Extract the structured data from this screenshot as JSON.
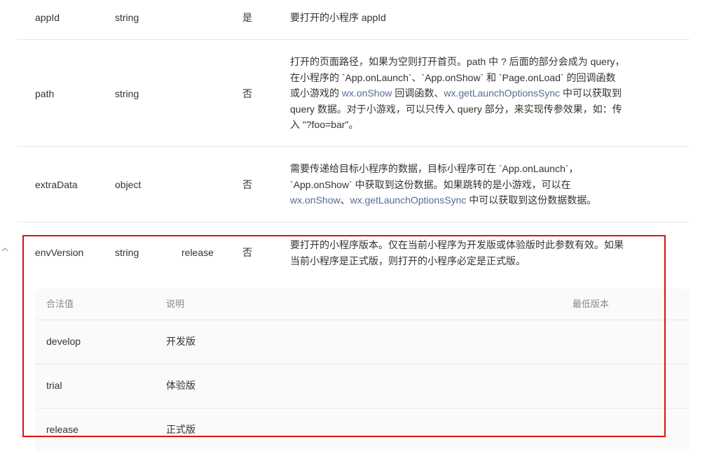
{
  "rows": [
    {
      "name": "appId",
      "type": "string",
      "default": "",
      "required": "是",
      "desc_parts": [
        "要打开的小程序 appId"
      ]
    },
    {
      "name": "path",
      "type": "string",
      "default": "",
      "required": "否",
      "desc": {
        "p1": "打开的页面路径，如果为空则打开首页。path 中 ? 后面的部分会成为 query，在小程序的 `App.onLaunch`、`App.onShow` 和 `Page.onLoad` 的回调函数或小游戏的 ",
        "link1": "wx.onShow",
        "p2": " 回调函数、",
        "link2": "wx.getLaunchOptionsSync",
        "p3": " 中可以获取到 query 数据。对于小游戏，可以只传入 query 部分，来实现传参效果，如：传入 \"?foo=bar\"。"
      }
    },
    {
      "name": "extraData",
      "type": "object",
      "default": "",
      "required": "否",
      "desc": {
        "p1": "需要传递给目标小程序的数据，目标小程序可在 `App.onLaunch`，`App.onShow` 中获取到这份数据。如果跳转的是小游戏，可以在 ",
        "link1": "wx.onShow",
        "p2": "、",
        "link2": "wx.getLaunchOptionsSync",
        "p3": " 中可以获取到这份数据数据。"
      }
    },
    {
      "name": "envVersion",
      "type": "string",
      "default": "release",
      "required": "否",
      "desc": "要打开的小程序版本。仅在当前小程序为开发版或体验版时此参数有效。如果当前小程序是正式版，则打开的小程序必定是正式版。"
    }
  ],
  "expand_icon": "chevron-up-icon",
  "subtable": {
    "headers": {
      "value": "合法值",
      "desc": "说明",
      "min": "最低版本"
    },
    "rows": [
      {
        "value": "develop",
        "desc": "开发版",
        "min": ""
      },
      {
        "value": "trial",
        "desc": "体验版",
        "min": ""
      },
      {
        "value": "release",
        "desc": "正式版",
        "min": ""
      }
    ]
  },
  "colors": {
    "link": "#576b95",
    "highlight": "#e01010",
    "text": "#333333",
    "muted": "#888888"
  }
}
